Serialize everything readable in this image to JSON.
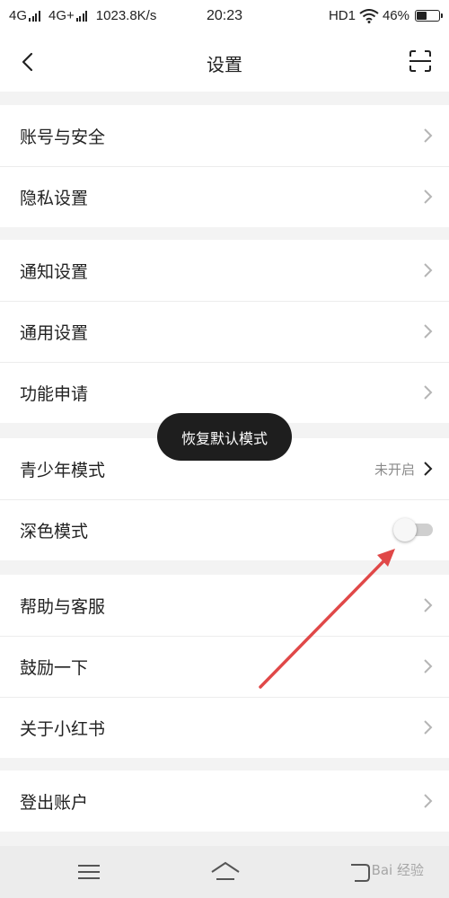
{
  "status_bar": {
    "network_1": "4G",
    "network_2": "4G+",
    "speed": "1023.8K/s",
    "time": "20:23",
    "hd": "HD1",
    "battery": "46%",
    "battery_level": 0.46
  },
  "header": {
    "title": "设置",
    "back_icon": "chevron-left-icon",
    "scan_icon": "scan-icon"
  },
  "groups": [
    {
      "items": [
        {
          "label": "账号与安全"
        },
        {
          "label": "隐私设置"
        }
      ]
    },
    {
      "items": [
        {
          "label": "通知设置"
        },
        {
          "label": "通用设置"
        },
        {
          "label": "功能申请"
        }
      ]
    },
    {
      "items": [
        {
          "label": "青少年模式",
          "value": "未开启"
        },
        {
          "label": "深色模式",
          "toggle": false
        }
      ]
    },
    {
      "items": [
        {
          "label": "帮助与客服"
        },
        {
          "label": "鼓励一下"
        },
        {
          "label": "关于小红书"
        }
      ]
    },
    {
      "items": [
        {
          "label": "登出账户"
        }
      ]
    }
  ],
  "toast": {
    "text": "恢复默认模式"
  },
  "annotation": {
    "color": "#e04848"
  },
  "nav_bar": {
    "watermark": "Bai 经验"
  },
  "colors": {
    "background": "#f3f3f3",
    "card": "#ffffff",
    "toast": "#1e1e1e",
    "toggle_off": "#cfcfcf"
  }
}
